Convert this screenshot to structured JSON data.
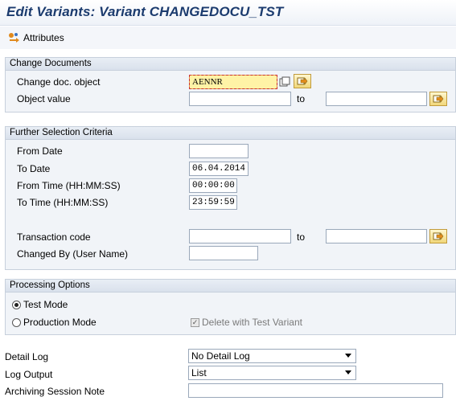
{
  "title": "Edit Variants: Variant CHANGEDOCU_TST",
  "toolbar": {
    "attributes_label": "Attributes"
  },
  "change_documents": {
    "header": "Change Documents",
    "doc_object_label": "Change doc. object",
    "doc_object_value": "AENNR",
    "object_value_label": "Object value",
    "object_value_from": "",
    "object_value_to": "",
    "to_label": "to"
  },
  "further_selection": {
    "header": "Further Selection Criteria",
    "from_date_label": "From Date",
    "from_date_value": "",
    "to_date_label": "To Date",
    "to_date_value": "06.04.2014",
    "from_time_label": "From Time (HH:MM:SS)",
    "from_time_value": "00:00:00",
    "to_time_label": "To Time (HH:MM:SS)",
    "to_time_value": "23:59:59",
    "transaction_code_label": "Transaction code",
    "transaction_from": "",
    "transaction_to": "",
    "to_label": "to",
    "changed_by_label": "Changed By (User Name)",
    "changed_by_value": ""
  },
  "processing": {
    "header": "Processing Options",
    "test_mode_label": "Test Mode",
    "test_mode_selected": true,
    "production_mode_label": "Production Mode",
    "delete_label": "Delete with Test Variant",
    "delete_checked": true
  },
  "bottom": {
    "detail_log_label": "Detail Log",
    "detail_log_value": "No Detail Log",
    "log_output_label": "Log Output",
    "log_output_value": "List",
    "archiving_label": "Archiving Session Note",
    "archiving_value": ""
  }
}
